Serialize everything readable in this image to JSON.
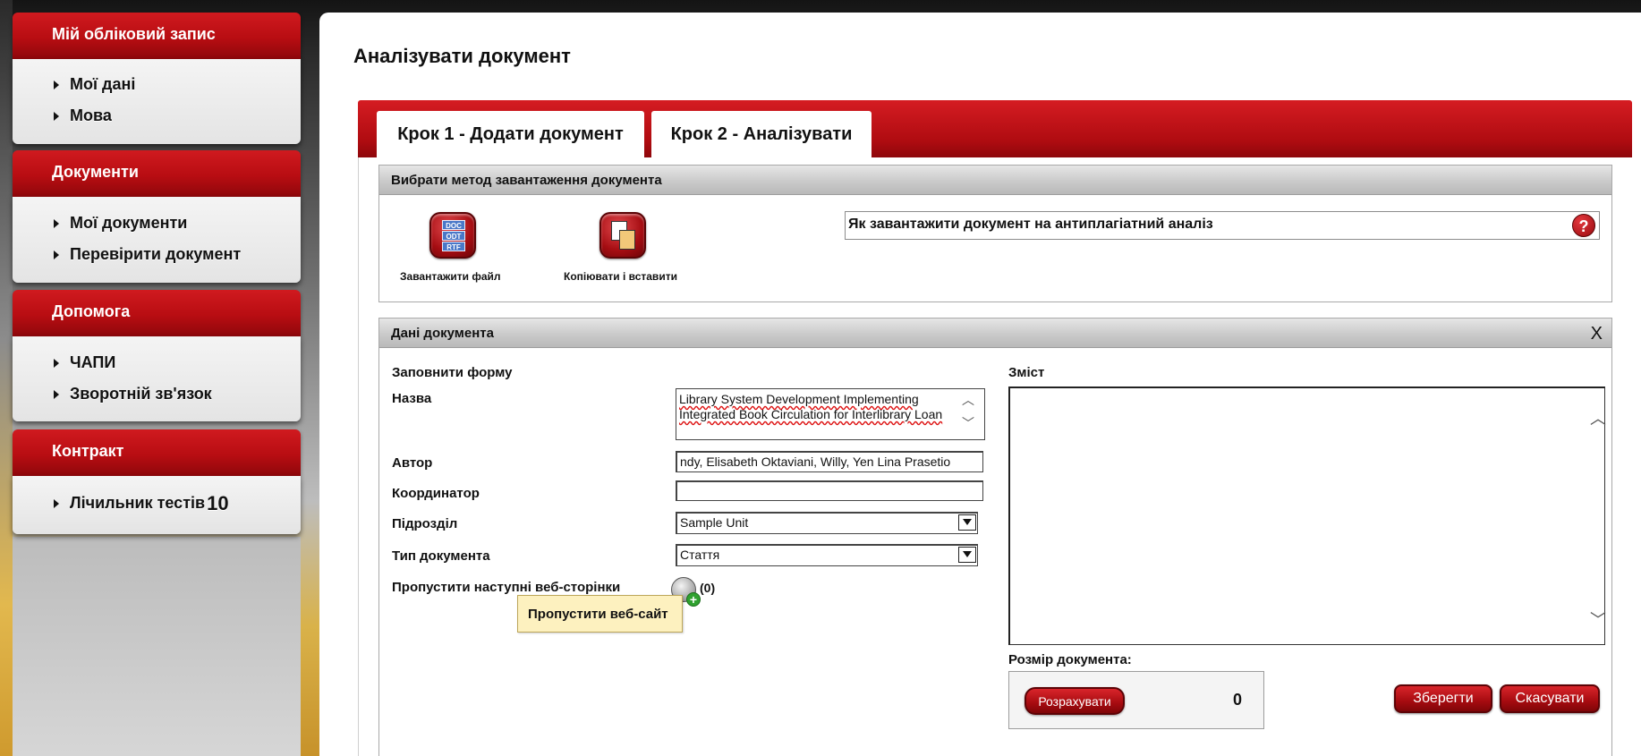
{
  "sidebar": {
    "sections": [
      {
        "title": "Мій обліковий запис",
        "items": [
          {
            "label": "Мої дані"
          },
          {
            "label": "Мова"
          }
        ]
      },
      {
        "title": "Документи",
        "items": [
          {
            "label": "Мої документи"
          },
          {
            "label": "Перевірити документ"
          }
        ]
      },
      {
        "title": "Допомога",
        "items": [
          {
            "label": "ЧАПИ"
          },
          {
            "label": "Зворотній зв'язок"
          }
        ]
      },
      {
        "title": "Контракт",
        "items": [
          {
            "label": "Лічильник тестів",
            "count": "10"
          }
        ]
      }
    ]
  },
  "page": {
    "title": "Аналізувати документ"
  },
  "tabs": [
    {
      "label": "Крок 1 - Додати документ",
      "active": true
    },
    {
      "label": "Крок 2 - Аналізувати",
      "active": false
    }
  ],
  "upload": {
    "header": "Вибрати метод завантаження документа",
    "file_label": "Завантажити файл",
    "file_badges": [
      "DOC",
      "ODT",
      "RTF"
    ],
    "paste_label": "Копіювати і вставити",
    "howto": "Як завантажити документ на антиплагіатний аналіз",
    "help_symbol": "?"
  },
  "doc": {
    "header": "Дані документа",
    "close": "X",
    "form_title": "Заповнити форму",
    "name_label": "Назва",
    "name_value": "Library System Development Implementing Integrated Book Circulation for Interlibrary Loan",
    "author_label": "Автор",
    "author_value": "ndy, Elisabeth Oktaviani, Willy, Yen Lina Prasetio",
    "coordinator_label": "Координатор",
    "coordinator_value": "",
    "unit_label": "Підрозділ",
    "unit_value": "Sample Unit",
    "type_label": "Тип документа",
    "type_value": "Стаття",
    "skip_label": "Пропустити наступні веб-сторінки",
    "skip_count": "(0)",
    "tooltip": "Пропустити веб-сайт",
    "content_label": "Зміст",
    "content_value": "",
    "size_label": "Розмір документа:",
    "calc_label": "Розрахувати",
    "size_value": "0",
    "save_label": "Зберегти",
    "cancel_label": "Скасувати"
  },
  "colors": {
    "brand_red": "#b80d12",
    "tooltip_bg": "#fdf1bf"
  }
}
